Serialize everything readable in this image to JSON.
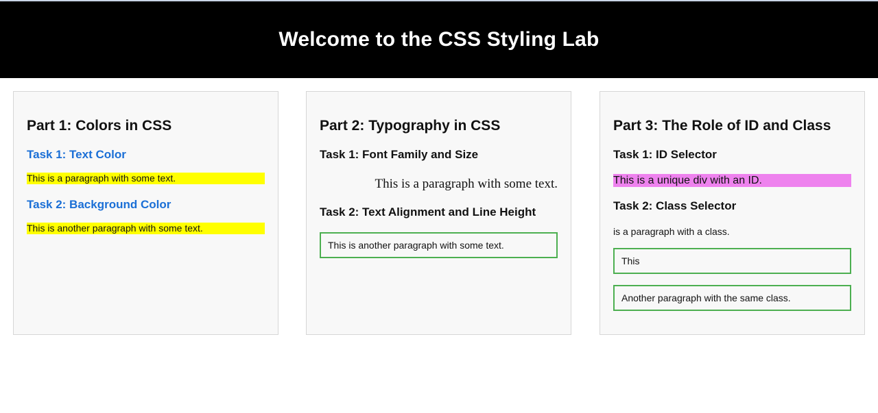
{
  "header": {
    "title": "Welcome to the CSS Styling Lab"
  },
  "colors": {
    "banner_bg": "#000000",
    "task_blue": "#1b6fd6",
    "highlight_yellow": "#ffff00",
    "highlight_violet": "#ee82ee",
    "box_border_green": "#4caf50",
    "panel_bg": "#f8f8f8"
  },
  "part1": {
    "title": "Part 1: Colors in CSS",
    "task1_title": "Task 1: Text Color",
    "task1_text": "This is a paragraph with some text.",
    "task2_title": "Task 2: Background Color",
    "task2_text": "This is another paragraph with some text."
  },
  "part2": {
    "title": "Part 2: Typography in CSS",
    "task1_title": "Task 1: Font Family and Size",
    "task1_text": "This is a paragraph with some text.",
    "task2_title": "Task 2: Text Alignment and Line Height",
    "task2_text": "This is another paragraph with some text."
  },
  "part3": {
    "title": "Part 3: The Role of ID and Class",
    "task1_title": "Task 1: ID Selector",
    "task1_text": "This is a unique div with an ID.",
    "task2_title": "Task 2: Class Selector",
    "task2_text": "is a paragraph with a class.",
    "box1_text": "This",
    "box2_text": "Another paragraph with the same class."
  }
}
